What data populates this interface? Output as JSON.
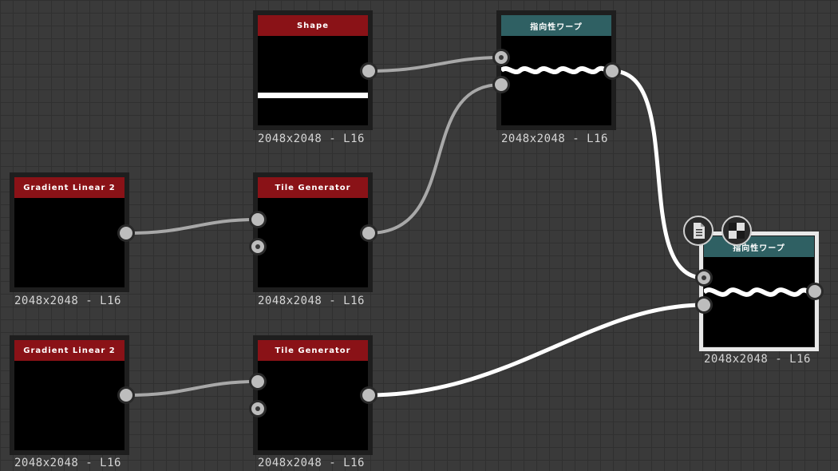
{
  "nodes": {
    "shape": {
      "title": "Shape",
      "res": "2048x2048 - L16"
    },
    "warp1": {
      "title": "指向性ワープ",
      "res": "2048x2048 - L16"
    },
    "grad1": {
      "title": "Gradient Linear 2",
      "res": "2048x2048 - L16"
    },
    "tile1": {
      "title": "Tile Generator",
      "res": "2048x2048 - L16"
    },
    "grad2": {
      "title": "Gradient Linear 2",
      "res": "2048x2048 - L16"
    },
    "tile2": {
      "title": "Tile Generator",
      "res": "2048x2048 - L16"
    },
    "warp2": {
      "title": "指向性ワープ",
      "res": "2048x2048 - L16"
    }
  },
  "toolbar_icons": [
    "document-icon",
    "checker-icon"
  ],
  "colors": {
    "canvas": "#3a3a3a",
    "header_generator": "#8a1217",
    "header_filter": "#2f6063",
    "wire": "#a8a8a8",
    "wire_active": "#ffffff"
  }
}
